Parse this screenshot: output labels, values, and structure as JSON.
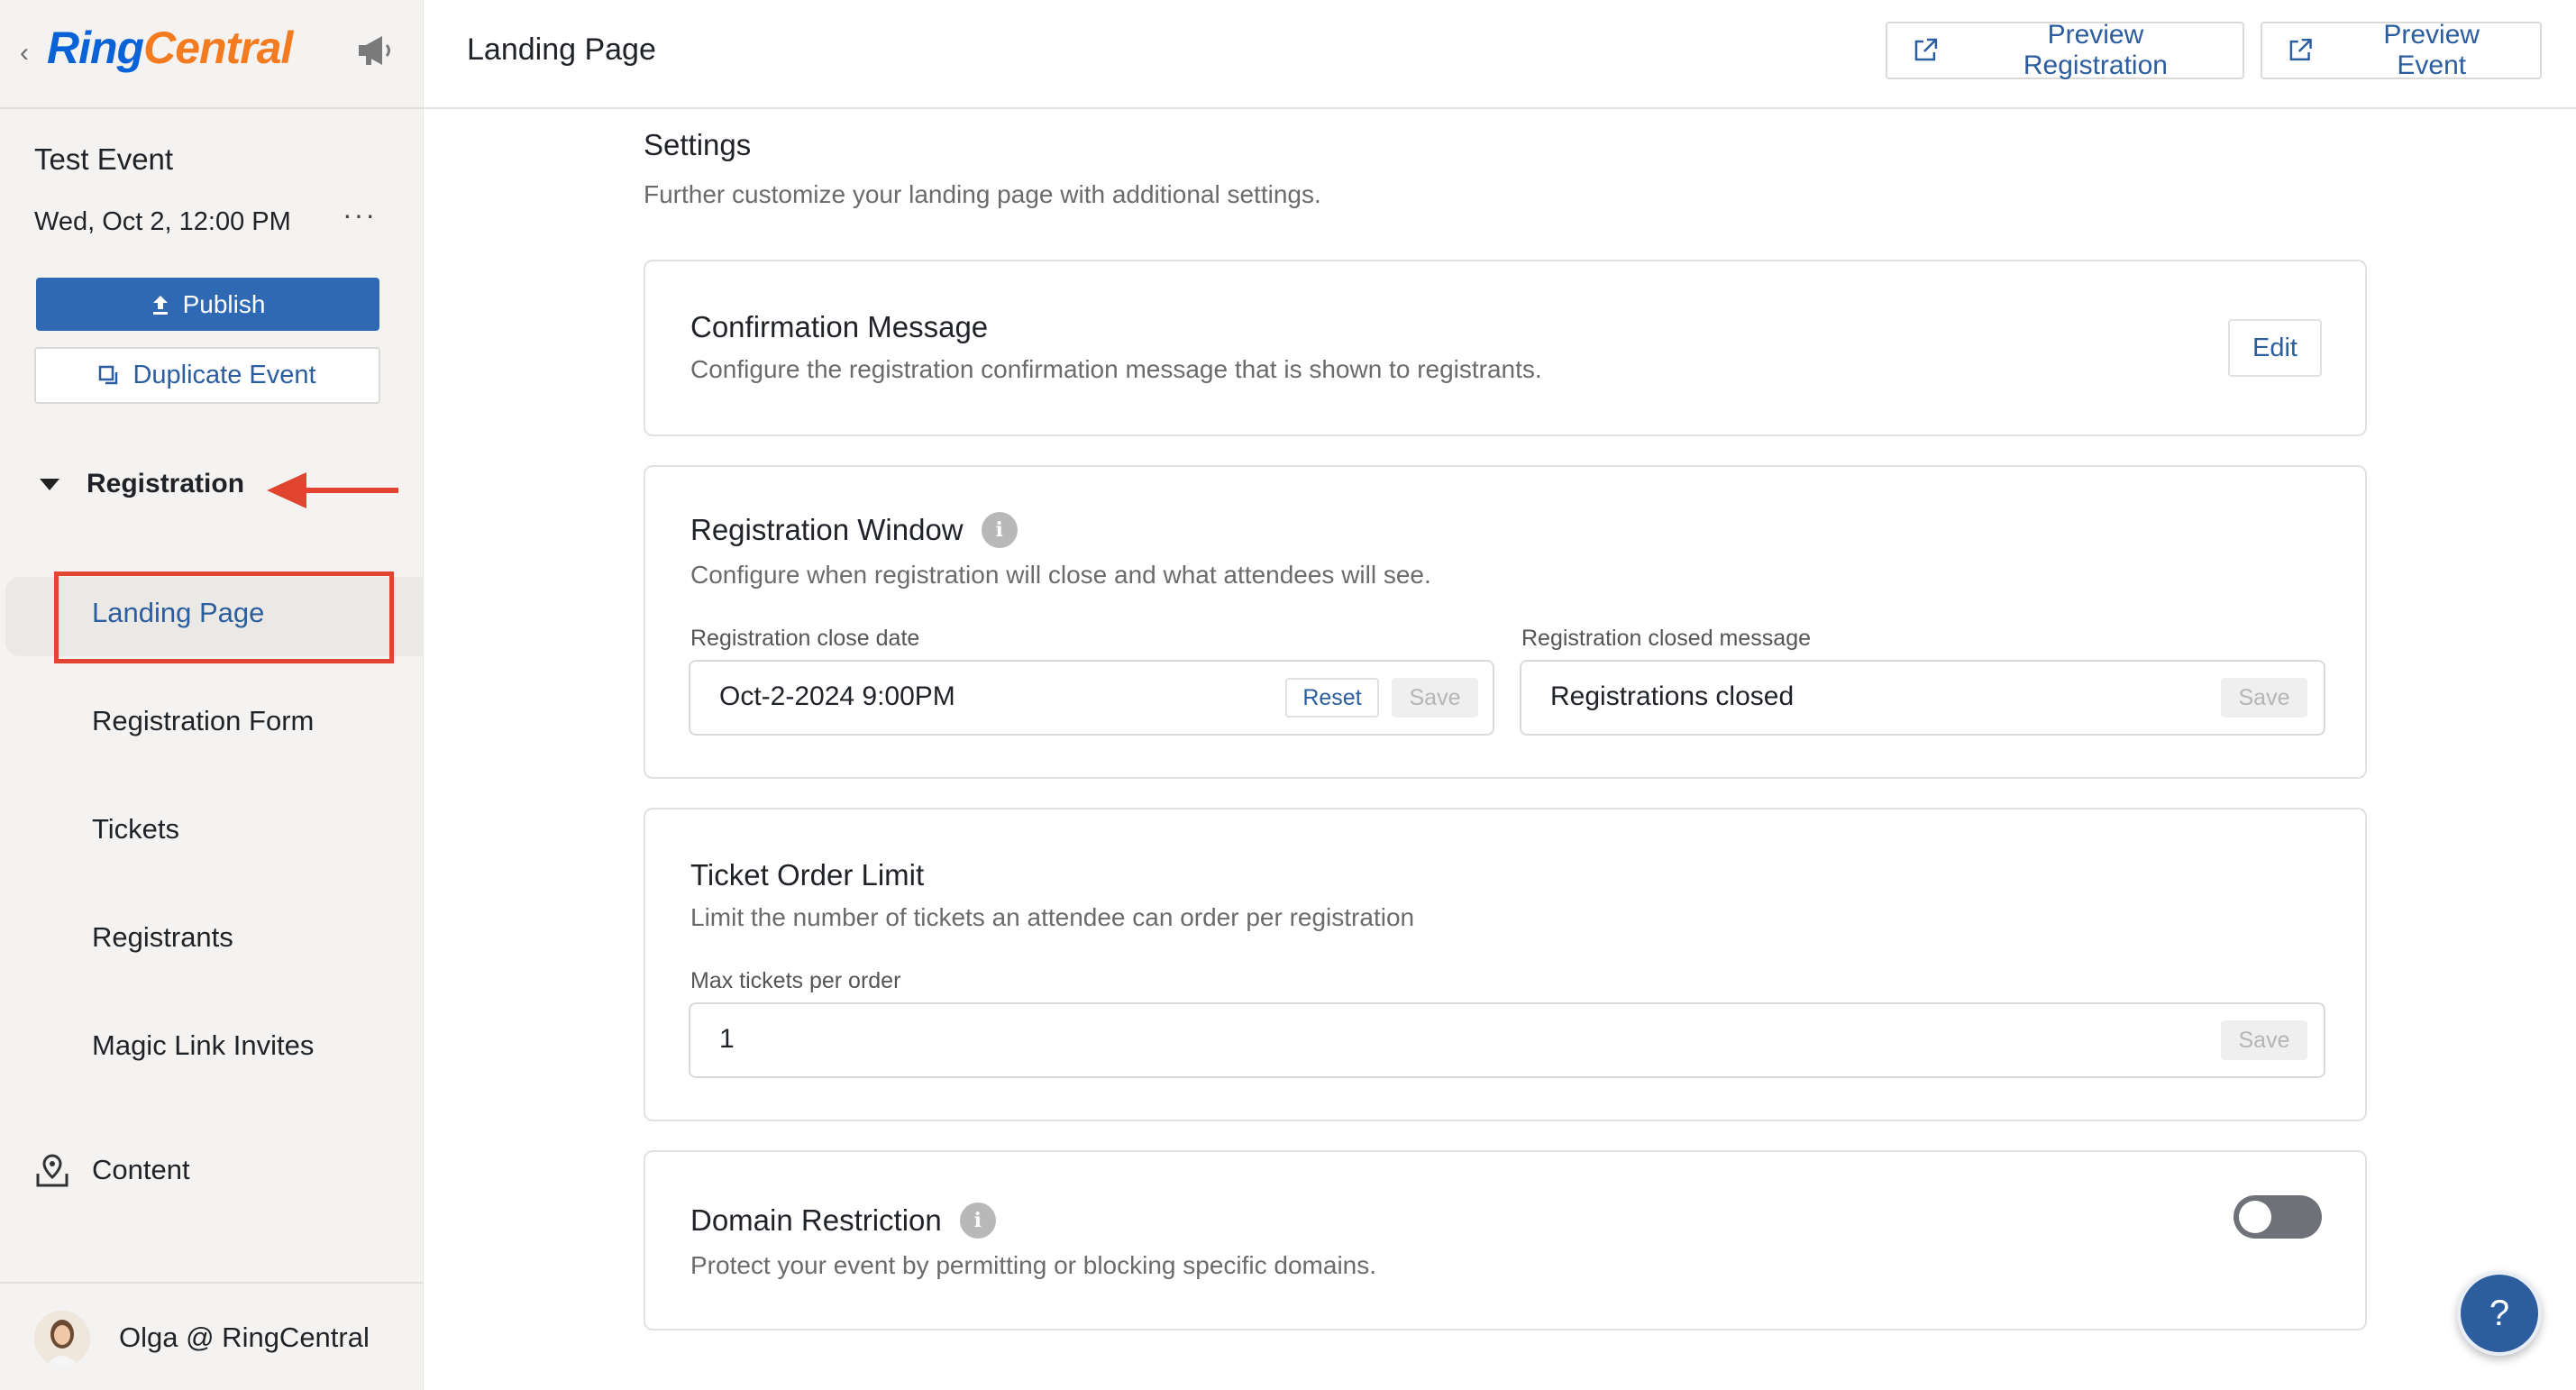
{
  "brand": {
    "logo_ring": "Ring",
    "logo_central": "Central",
    "logo_blue": "#0a63d6",
    "logo_orange": "#f47b20"
  },
  "sidebar": {
    "event_title": "Test Event",
    "event_date": "Wed, Oct 2, 12:00 PM",
    "more_label": "···",
    "publish_label": "Publish",
    "duplicate_label": "Duplicate Event",
    "section_label": "Registration",
    "items": [
      {
        "label": "Landing Page",
        "active": true
      },
      {
        "label": "Registration Form"
      },
      {
        "label": "Tickets"
      },
      {
        "label": "Registrants"
      },
      {
        "label": "Magic Link Invites"
      }
    ],
    "content_label": "Content",
    "user_name": "Olga @ RingCentral"
  },
  "header": {
    "title": "Landing Page",
    "preview_registration": "Preview Registration",
    "preview_event": "Preview Event"
  },
  "settings": {
    "heading": "Settings",
    "subtitle": "Further customize your landing page with additional settings."
  },
  "confirmation": {
    "title": "Confirmation Message",
    "desc": "Configure the registration confirmation message that is shown to registrants.",
    "edit_label": "Edit"
  },
  "registration_window": {
    "title": "Registration Window",
    "desc": "Configure when registration will close and what attendees will see.",
    "close_date_label": "Registration close date",
    "close_date_value": "Oct-2-2024 9:00PM",
    "reset_label": "Reset",
    "save_label": "Save",
    "closed_msg_label": "Registration closed message",
    "closed_msg_value": "Registrations closed",
    "closed_save_label": "Save"
  },
  "ticket_limit": {
    "title": "Ticket Order Limit",
    "desc": "Limit the number of tickets an attendee can order per registration",
    "max_label": "Max tickets per order",
    "max_value": "1",
    "save_label": "Save"
  },
  "domain_restriction": {
    "title": "Domain Restriction",
    "desc": "Protect your event by permitting or blocking specific domains.",
    "enabled": false
  },
  "help": {
    "label": "?"
  },
  "colors": {
    "accent": "#2c5d9e",
    "publish_bg": "#2f69b4",
    "annotation_red": "#e1442f"
  }
}
